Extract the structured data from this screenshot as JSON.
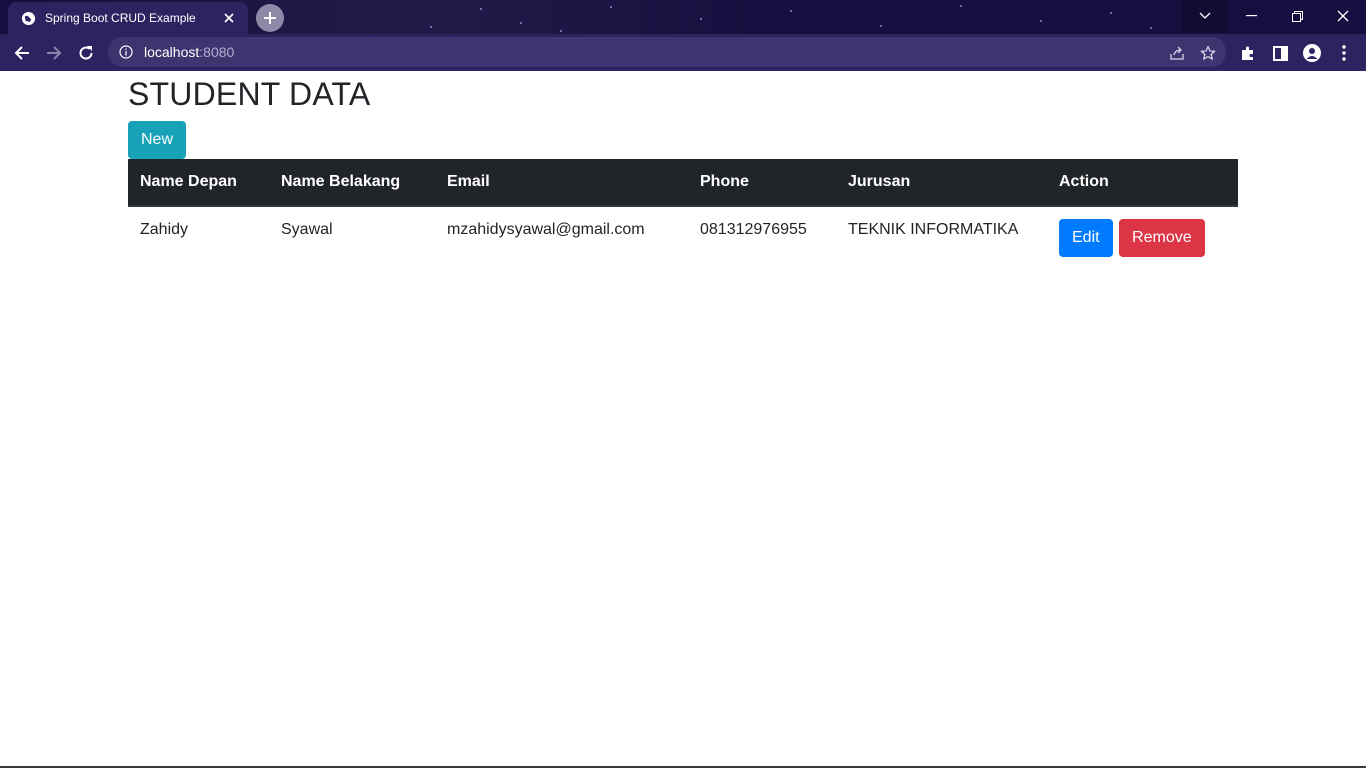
{
  "browser": {
    "tab_title": "Spring Boot CRUD Example",
    "url_host": "localhost",
    "url_port": ":8080"
  },
  "page": {
    "heading": "STUDENT DATA",
    "new_button": "New",
    "table": {
      "headers": [
        "Name Depan",
        "Name Belakang",
        "Email",
        "Phone",
        "Jurusan",
        "Action"
      ],
      "rows": [
        {
          "first_name": "Zahidy",
          "last_name": "Syawal",
          "email": "mzahidysyawal@gmail.com",
          "phone": "081312976955",
          "jurusan": "TEKNIK INFORMATIKA",
          "edit_label": "Edit",
          "remove_label": "Remove"
        }
      ]
    }
  },
  "colors": {
    "new_button": "#17a2b8",
    "edit_button": "#007bff",
    "remove_button": "#dc3545",
    "table_header": "#212529",
    "browser_frame": "#1a1247"
  }
}
